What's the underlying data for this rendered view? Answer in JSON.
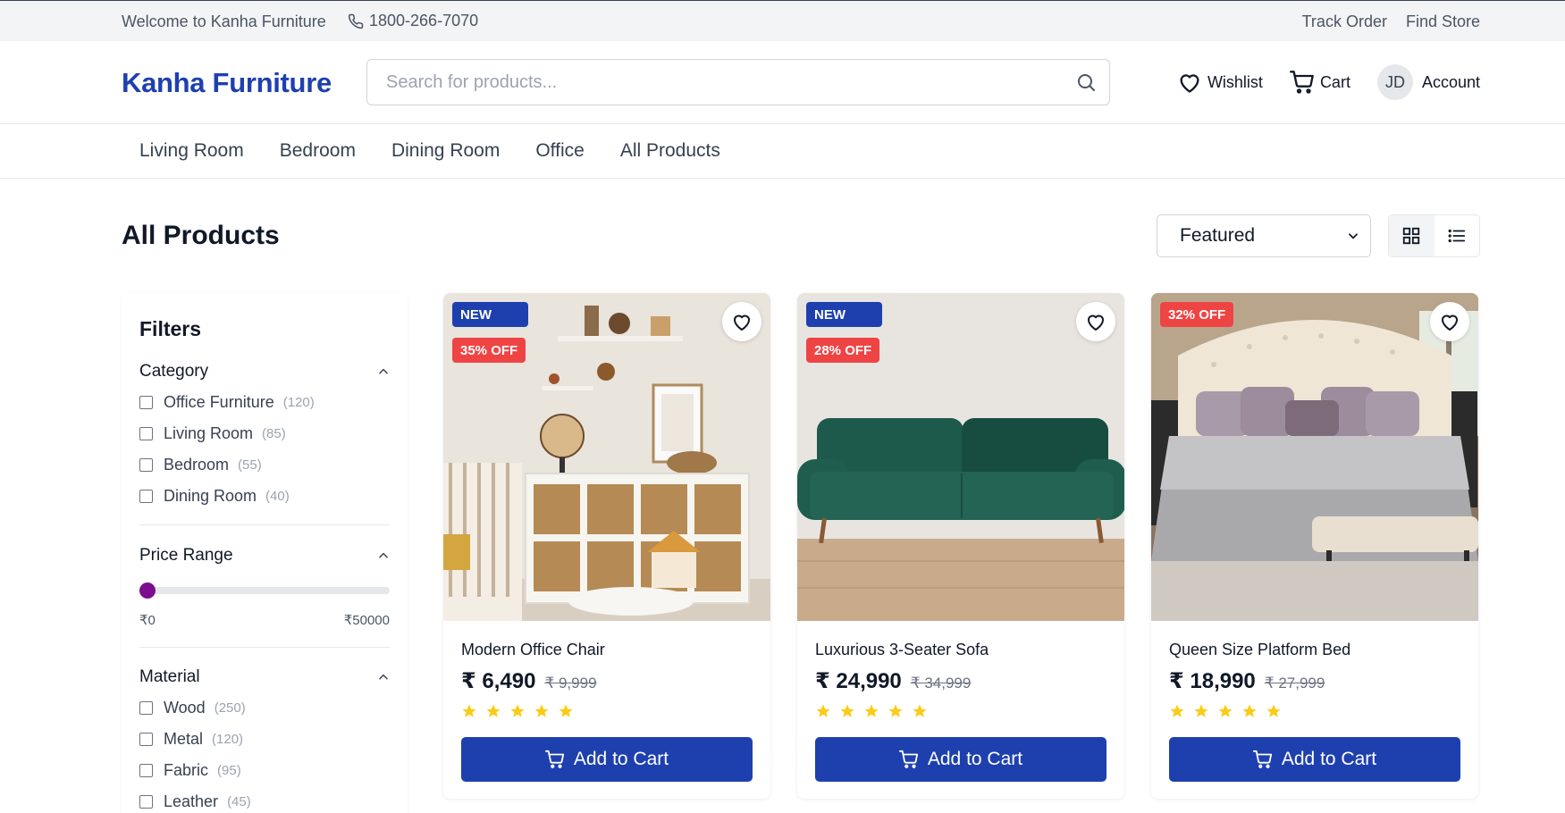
{
  "topbar": {
    "welcome": "Welcome to Kanha Furniture",
    "phone": "1800-266-7070",
    "links": [
      "Track Order",
      "Find Store"
    ]
  },
  "header": {
    "logo": "Kanha Furniture",
    "search_placeholder": "Search for products...",
    "wishlist": "Wishlist",
    "cart": "Cart",
    "avatar_initials": "JD",
    "account": "Account"
  },
  "nav": {
    "items": [
      "Living Room",
      "Bedroom",
      "Dining Room",
      "Office",
      "All Products"
    ]
  },
  "page": {
    "title": "All Products",
    "sort_selected": "Featured",
    "view_mode": "grid"
  },
  "filters": {
    "title": "Filters",
    "category": {
      "title": "Category",
      "options": [
        {
          "label": "Office Furniture",
          "count": "(120)"
        },
        {
          "label": "Living Room",
          "count": "(85)"
        },
        {
          "label": "Bedroom",
          "count": "(55)"
        },
        {
          "label": "Dining Room",
          "count": "(40)"
        }
      ]
    },
    "price": {
      "title": "Price Range",
      "min_label": "₹0",
      "max_label": "₹50000",
      "value_fraction": 0
    },
    "material": {
      "title": "Material",
      "options": [
        {
          "label": "Wood",
          "count": "(250)"
        },
        {
          "label": "Metal",
          "count": "(120)"
        },
        {
          "label": "Fabric",
          "count": "(95)"
        },
        {
          "label": "Leather",
          "count": "(45)"
        }
      ]
    }
  },
  "products": [
    {
      "name": "Modern Office Chair",
      "price": "₹ 6,490",
      "was": "₹ 9,999",
      "new_badge": "NEW",
      "discount": "35% OFF",
      "rating": 5,
      "cta": "Add to Cart"
    },
    {
      "name": "Luxurious 3-Seater Sofa",
      "price": "₹ 24,990",
      "was": "₹ 34,999",
      "new_badge": "NEW",
      "discount": "28% OFF",
      "rating": 5,
      "cta": "Add to Cart"
    },
    {
      "name": "Queen Size Platform Bed",
      "price": "₹ 18,990",
      "was": "₹ 27,999",
      "new_badge": "",
      "discount": "32% OFF",
      "rating": 5,
      "cta": "Add to Cart"
    }
  ],
  "colors": {
    "brand": "#1e40af",
    "discount": "#ef4444",
    "star": "#facc15",
    "slider_thumb": "#7c0d8f"
  }
}
